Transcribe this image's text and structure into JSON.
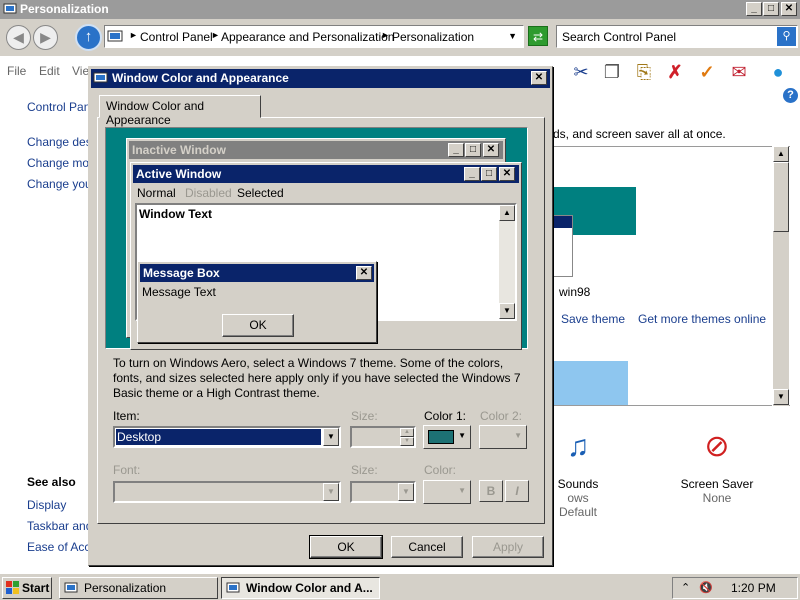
{
  "explorer": {
    "title": "Personalization",
    "caption_buttons": [
      "_",
      "□",
      "✕"
    ],
    "address": {
      "crumbs": [
        "Control Panel",
        "Appearance and Personalization",
        "Personalization"
      ],
      "search_placeholder": "Search Control Panel"
    },
    "menu": [
      "File",
      "Edit",
      "Vie"
    ],
    "left_nav": {
      "home": "Control Pane",
      "links": [
        "Change desk",
        "Change mou",
        "Change your"
      ],
      "see_also_title": "See also",
      "see_also": [
        "Display",
        "Taskbar and",
        "Ease of Acce"
      ]
    },
    "description_tail": "ds, and screen saver all at once.",
    "theme": {
      "name": "win98",
      "save_link": "Save theme",
      "online_link": "Get more themes online"
    },
    "bottom": [
      {
        "label": "Sounds",
        "sub": "ows Default",
        "icon": "sounds-icon"
      },
      {
        "label": "Screen Saver",
        "sub": "None",
        "icon": "screensaver-icon"
      }
    ]
  },
  "dialog": {
    "title": "Window Color and Appearance",
    "tab": "Window Color and Appearance",
    "preview": {
      "inactive_title": "Inactive Window",
      "active_title": "Active Window",
      "menu": [
        "Normal",
        "Disabled",
        "Selected"
      ],
      "window_text": "Window Text",
      "msgbox_title": "Message Box",
      "msgbox_text": "Message Text",
      "ok": "OK"
    },
    "info": "To turn on Windows Aero, select a Windows 7 theme.  Some of the colors, fonts, and sizes selected here apply only if you have selected the Windows 7 Basic theme or a High Contrast theme.",
    "labels": {
      "item": "Item:",
      "size": "Size:",
      "color1": "Color 1:",
      "color2": "Color 2:",
      "font": "Font:",
      "font_size": "Size:",
      "font_color": "Color:"
    },
    "item_value": "Desktop",
    "color1": "#1d7174",
    "bold_btn": "B",
    "italic_btn": "I",
    "buttons": {
      "ok": "OK",
      "cancel": "Cancel",
      "apply": "Apply"
    }
  },
  "taskbar": {
    "start": "Start",
    "tasks": [
      "Personalization",
      "Window Color and A..."
    ],
    "time": "1:20 PM"
  }
}
